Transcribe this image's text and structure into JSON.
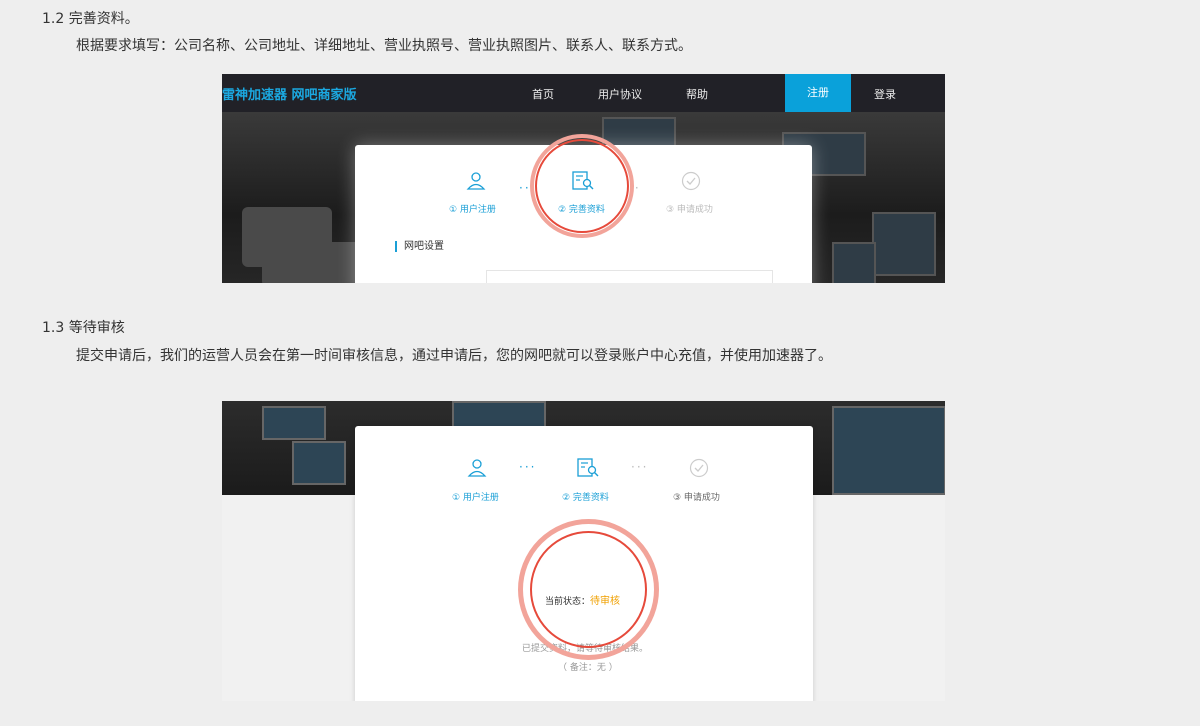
{
  "doc": {
    "section_12_heading": "1.2 完善资料。",
    "section_12_text": "根据要求填写：公司名称、公司地址、详细地址、营业执照号、营业执照图片、联系人、联系方式。",
    "section_13_heading": "1.3 等待审核",
    "section_13_text": "提交申请后，我们的运营人员会在第一时间审核信息，通过申请后，您的网吧就可以登录账户中心充值，并使用加速器了。"
  },
  "shot1": {
    "brand": "雷神加速器 网吧商家版",
    "nav": {
      "home": "首页",
      "agreement": "用户协议",
      "help": "帮助",
      "register": "注册",
      "login": "登录"
    },
    "steps": [
      "① 用户注册",
      "② 完善资料",
      "③ 申请成功"
    ],
    "section_title": "网吧设置"
  },
  "shot2": {
    "steps": [
      "① 用户注册",
      "② 完善资料",
      "③ 申请成功"
    ],
    "status_label": "当前状态：",
    "status_value": "待审核",
    "note_line": "已提交资料，请等待审核结果。",
    "remark": "（ 备注：无 ）"
  },
  "colors": {
    "accent": "#1a9fd6",
    "pending": "#f0a000",
    "highlight": "#e64a3b"
  }
}
